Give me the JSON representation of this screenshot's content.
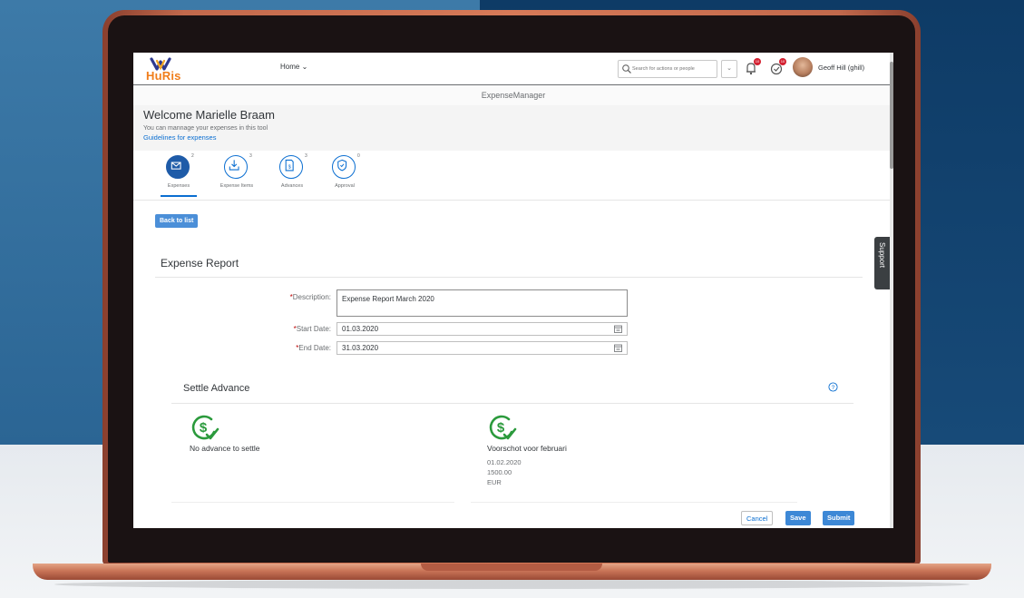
{
  "shell": {
    "logo_text": "HuRis",
    "home_menu": "Home ⌄",
    "search_placeholder": "Search for actions or people",
    "search_dropdown": "⌄",
    "notifications_count": "10",
    "approvals_count": "10",
    "user_name": "Geoff Hill (ghill)"
  },
  "app": {
    "title": "ExpenseManager"
  },
  "welcome": {
    "title": "Welcome Marielle Braam",
    "subtitle": "You can mannage your expenses in this tool",
    "link": "Guidelines for expenses"
  },
  "tabs": [
    {
      "label": "Expenses",
      "count": "2",
      "icon": "envelope-icon",
      "active": true
    },
    {
      "label": "Expense Items",
      "count": "3",
      "icon": "download-tray-icon",
      "active": false
    },
    {
      "label": "Advances",
      "count": "3",
      "icon": "money-document-icon",
      "active": false
    },
    {
      "label": "Approval",
      "count": "0",
      "icon": "shield-check-icon",
      "active": false
    }
  ],
  "actions": {
    "back": "Back to list"
  },
  "report": {
    "title": "Expense Report",
    "description_label": "Description:",
    "description_value": "Expense Report March 2020",
    "start_label": "Start Date:",
    "start_value": "01.03.2020",
    "end_label": "End Date:",
    "end_value": "31.03.2020",
    "required_mark": "*"
  },
  "settle": {
    "title": "Settle Advance",
    "left": {
      "title": "No advance to settle"
    },
    "right": {
      "title": "Voorschot voor februari",
      "date": "01.02.2020",
      "amount": "1500.00",
      "currency": "EUR"
    }
  },
  "footer": {
    "cancel": "Cancel",
    "save": "Save",
    "submit": "Submit"
  },
  "support": "Support",
  "colors": {
    "brand_blue": "#0a6ed1",
    "success_green": "#2b9a3c",
    "logo_orange": "#f07d1a"
  }
}
